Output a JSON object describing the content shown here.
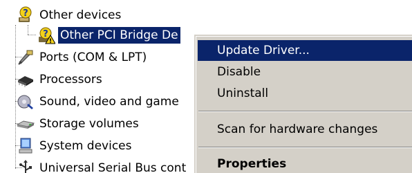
{
  "device_tree": {
    "items": [
      {
        "label": "Other devices",
        "icon": "unknown-device-icon",
        "selected": false
      },
      {
        "label": "Other PCI Bridge De",
        "icon": "unknown-device-warning-icon",
        "selected": true
      },
      {
        "label": "Ports (COM & LPT)",
        "icon": "port-icon",
        "selected": false
      },
      {
        "label": "Processors",
        "icon": "processor-icon",
        "selected": false
      },
      {
        "label": "Sound, video and game",
        "icon": "sound-icon",
        "selected": false
      },
      {
        "label": "Storage volumes",
        "icon": "storage-volume-icon",
        "selected": false
      },
      {
        "label": "System devices",
        "icon": "system-device-icon",
        "selected": false
      },
      {
        "label": "Universal Serial Bus cont",
        "icon": "usb-icon",
        "selected": false
      }
    ]
  },
  "context_menu": {
    "items": [
      {
        "label": "Update Driver...",
        "highlighted": true,
        "bold": false
      },
      {
        "label": "Disable",
        "highlighted": false,
        "bold": false
      },
      {
        "label": "Uninstall",
        "highlighted": false,
        "bold": false
      },
      {
        "label": "Scan for hardware changes",
        "highlighted": false,
        "bold": false
      },
      {
        "label": "Properties",
        "highlighted": false,
        "bold": true
      }
    ]
  },
  "colors": {
    "selection": "#0a246a",
    "menu_background": "#d4d0c8",
    "background": "#ffffff"
  }
}
